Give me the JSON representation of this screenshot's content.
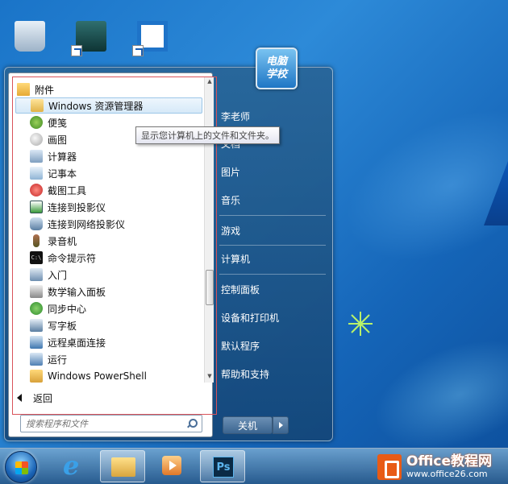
{
  "desktop": {
    "top_labels": [
      "…",
      "…"
    ],
    "icons": [
      "recycle-bin",
      "3ds-max",
      "shortcut-app"
    ]
  },
  "start_menu": {
    "programs": {
      "folder_label": "附件",
      "items": [
        {
          "label": "Windows 资源管理器",
          "icon": "explorer-icon"
        },
        {
          "label": "便笺",
          "icon": "sticky-notes-icon"
        },
        {
          "label": "画图",
          "icon": "paint-icon"
        },
        {
          "label": "计算器",
          "icon": "calculator-icon"
        },
        {
          "label": "记事本",
          "icon": "notepad-icon"
        },
        {
          "label": "截图工具",
          "icon": "snipping-tool-icon"
        },
        {
          "label": "连接到投影仪",
          "icon": "projector-icon"
        },
        {
          "label": "连接到网络投影仪",
          "icon": "network-projector-icon"
        },
        {
          "label": "录音机",
          "icon": "microphone-icon"
        },
        {
          "label": "命令提示符",
          "icon": "command-prompt-icon"
        },
        {
          "label": "入门",
          "icon": "getting-started-icon"
        },
        {
          "label": "数学输入面板",
          "icon": "math-input-icon"
        },
        {
          "label": "同步中心",
          "icon": "sync-center-icon"
        },
        {
          "label": "写字板",
          "icon": "wordpad-icon"
        },
        {
          "label": "远程桌面连接",
          "icon": "remote-desktop-icon"
        },
        {
          "label": "运行",
          "icon": "run-icon"
        },
        {
          "label": "Windows PowerShell",
          "icon": "folder-icon"
        }
      ]
    },
    "back_label": "返回",
    "search": {
      "placeholder": "搜索程序和文件"
    },
    "user_picture_text": "电脑\n学校",
    "right_items": [
      "李老师",
      "文档",
      "图片",
      "音乐",
      "游戏",
      "计算机",
      "控制面板",
      "设备和打印机",
      "默认程序",
      "帮助和支持"
    ],
    "shutdown_label": "关机",
    "tooltip": "显示您计算机上的文件和文件夹。"
  },
  "taskbar": {
    "items": [
      "start-orb",
      "internet-explorer",
      "windows-explorer",
      "media-player",
      "photoshop"
    ],
    "ps_label": "Ps"
  },
  "watermark": {
    "title": "Office教程网",
    "url": "www.office26.com"
  },
  "colors": {
    "desktop_blue": "#1a74c8",
    "selection_border": "#d9535a",
    "highlight": "#d6e9f8"
  }
}
